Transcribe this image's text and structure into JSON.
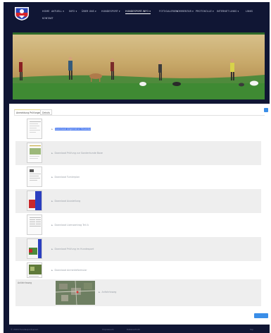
{
  "nav": {
    "items": [
      {
        "label": "HOME",
        "active": false
      },
      {
        "label": "AKTUELL",
        "active": false
      },
      {
        "label": "INFO",
        "active": false
      },
      {
        "label": "ÜBER UNS",
        "active": false
      },
      {
        "label": "HUNDESPORT",
        "active": false
      },
      {
        "label": "HUNDESPORT-INFO",
        "active": true
      },
      {
        "label": "FOTOGALERIE",
        "active": false
      },
      {
        "label": "KOMMENTAR",
        "active": false
      },
      {
        "label": "PROTOKOLLE",
        "active": false
      },
      {
        "label": "INTERNET LINKS",
        "active": false
      },
      {
        "label": "LINKS",
        "active": false
      }
    ],
    "second_line": [
      "KONTAKT"
    ]
  },
  "tabs": [
    {
      "label": "Anmeldung Prüfungen",
      "active": true
    },
    {
      "label": "Details",
      "active": false
    }
  ],
  "rows": [
    {
      "link": "Download Allgemeine Hinweise",
      "highlighted": true
    },
    {
      "link": "Download Prüfung zur Sonderkunde Boxe",
      "highlighted": false
    },
    {
      "link": "Download Turnierplan",
      "highlighted": false
    },
    {
      "link": "Download Ausstellung",
      "highlighted": false
    },
    {
      "link": "Download Lizenzantrag Teil A",
      "highlighted": false
    },
    {
      "link": "Download Prüfung im Hundesport",
      "highlighted": false
    },
    {
      "link": "Download Anmeldeformular",
      "highlighted": false
    }
  ],
  "map_row": {
    "label": "Anfahrtsweg",
    "link": "Anfahrtsweg"
  },
  "footer": {
    "left": "© 2016 Hundesportverein",
    "middle_a": "Impressum",
    "middle_b": "Datenschutz",
    "right": "Top"
  },
  "colors": {
    "background": "#101634",
    "accent": "#3a8ee8",
    "highlight": "#4d7cf0"
  }
}
